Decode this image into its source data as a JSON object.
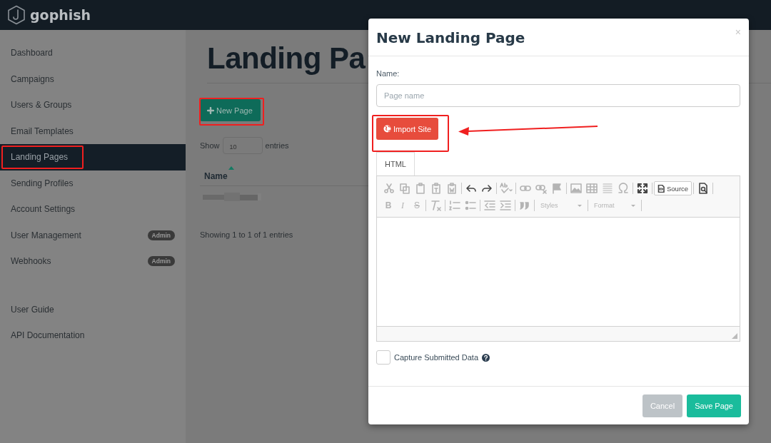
{
  "navbar": {
    "brand": "gophish"
  },
  "sidebar": {
    "items": [
      {
        "label": "Dashboard",
        "selected": false
      },
      {
        "label": "Campaigns",
        "selected": false
      },
      {
        "label": "Users & Groups",
        "selected": false
      },
      {
        "label": "Email Templates",
        "selected": false
      },
      {
        "label": "Landing Pages",
        "selected": true
      },
      {
        "label": "Sending Profiles",
        "selected": false
      },
      {
        "label": "Account Settings",
        "selected": false
      },
      {
        "label": "User Management",
        "selected": false,
        "badge": "Admin"
      },
      {
        "label": "Webhooks",
        "selected": false,
        "badge": "Admin"
      }
    ],
    "links": [
      {
        "label": "User Guide"
      },
      {
        "label": "API Documentation"
      }
    ]
  },
  "main": {
    "title": "Landing Pa",
    "new_button": "New Page",
    "show_label": "Show",
    "entries_value": "10",
    "entries_label": "entries",
    "columns": [
      {
        "label": "Name",
        "sorted": true
      }
    ],
    "rows": [
      {
        "kind": "redacted"
      }
    ],
    "info": "Showing 1 to 1 of 1 entries"
  },
  "modal": {
    "title": "New Landing Page",
    "close": "×",
    "name_label": "Name:",
    "name_field": {
      "placeholder": "Page name"
    },
    "import_button": "Import Site",
    "tabs": [
      {
        "label": "HTML",
        "selected": true
      }
    ],
    "toolbar": [
      [
        [
          {
            "kind": "icon",
            "disabled": true
          },
          {
            "kind": "icon",
            "disabled": true
          },
          {
            "kind": "icon",
            "disabled": true
          },
          {
            "kind": "icon",
            "disabled": true
          },
          {
            "kind": "icon",
            "disabled": true
          }
        ],
        [
          {
            "kind": "icon",
            "disabled": false
          },
          {
            "kind": "icon",
            "disabled": false
          }
        ],
        [
          {
            "kind": "icon",
            "disabled": true
          }
        ],
        [
          {
            "kind": "icon",
            "disabled": true
          },
          {
            "kind": "icon",
            "disabled": true
          },
          {
            "kind": "icon",
            "disabled": true
          }
        ],
        [
          {
            "kind": "icon",
            "disabled": true
          },
          {
            "kind": "icon",
            "disabled": true
          },
          {
            "kind": "icon",
            "disabled": true
          },
          {
            "kind": "icon",
            "disabled": true
          }
        ],
        [
          {
            "kind": "icon",
            "disabled": false
          }
        ],
        [
          {
            "kind": "button",
            "text": "Source",
            "disabled": false
          }
        ],
        [
          {
            "kind": "icon",
            "disabled": false
          }
        ]
      ],
      [
        [
          {
            "kind": "text",
            "text": "B",
            "disabled": true
          },
          {
            "kind": "text",
            "text": "I",
            "disabled": true
          },
          {
            "kind": "text",
            "text": "S",
            "disabled": true
          }
        ],
        [
          {
            "kind": "icon",
            "disabled": true
          }
        ],
        [
          {
            "kind": "icon",
            "disabled": true
          },
          {
            "kind": "icon",
            "disabled": true
          }
        ],
        [
          {
            "kind": "icon",
            "disabled": true
          },
          {
            "kind": "icon",
            "disabled": true
          }
        ],
        [
          {
            "kind": "icon",
            "disabled": true
          }
        ],
        [
          {
            "kind": "combo",
            "text": "Styles",
            "disabled": true
          }
        ],
        [
          {
            "kind": "combo",
            "text": "Format",
            "disabled": true
          }
        ]
      ]
    ],
    "capture": {
      "label": "Capture Submitted Data",
      "checked": false
    },
    "buttons": [
      {
        "label": "Cancel",
        "kind": "secondary"
      },
      {
        "label": "Save Page",
        "kind": "primary"
      }
    ]
  }
}
